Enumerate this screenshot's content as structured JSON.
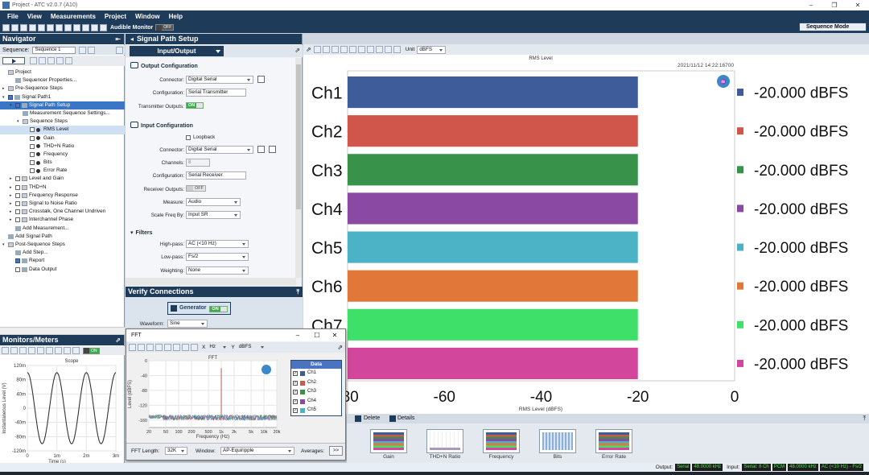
{
  "window": {
    "title": "Project - ATC v2.0.7 (A10)",
    "controls": [
      "–",
      "❐",
      "✕"
    ]
  },
  "menu": [
    "File",
    "View",
    "Measurements",
    "Project",
    "Window",
    "Help"
  ],
  "toolbar": {
    "audible_monitor_label": "Audible Monitor",
    "audible_monitor_state": "OFF",
    "sequence_mode": "Sequence Mode"
  },
  "navigator": {
    "title": "Navigator",
    "sequence_label": "Sequence:",
    "sequence_value": "Sequence 1",
    "tree": [
      {
        "label": "Project",
        "level": 0,
        "icon": "folder",
        "arrow": "",
        "check": ""
      },
      {
        "label": "Sequencer Properties...",
        "level": 1,
        "icon": "gear",
        "arrow": "",
        "check": ""
      },
      {
        "label": "Pre-Sequence Steps",
        "level": 0,
        "icon": "folder",
        "arrow": "▸",
        "check": ""
      },
      {
        "label": "Signal Path1",
        "level": 0,
        "icon": "box",
        "arrow": "▾",
        "check": "on"
      },
      {
        "label": "Signal Path Setup",
        "level": 1,
        "icon": "box",
        "arrow": "▾",
        "check": "on",
        "state": "selected"
      },
      {
        "label": "Measurement Sequence Settings...",
        "level": 2,
        "icon": "gear",
        "arrow": "",
        "check": ""
      },
      {
        "label": "Sequence Steps",
        "level": 2,
        "icon": "folder",
        "arrow": "▾",
        "check": ""
      },
      {
        "label": "RMS Level",
        "level": 3,
        "icon": "dot",
        "arrow": "",
        "check": "off",
        "state": "highlight"
      },
      {
        "label": "Gain",
        "level": 3,
        "icon": "dot",
        "arrow": "",
        "check": "off"
      },
      {
        "label": "THD+N Ratio",
        "level": 3,
        "icon": "dot",
        "arrow": "",
        "check": "off"
      },
      {
        "label": "Frequency",
        "level": 3,
        "icon": "dot",
        "arrow": "",
        "check": "off"
      },
      {
        "label": "Bits",
        "level": 3,
        "icon": "dot",
        "arrow": "",
        "check": "off"
      },
      {
        "label": "Error Rate",
        "level": 3,
        "icon": "dot",
        "arrow": "",
        "check": "off"
      },
      {
        "label": "Level and Gain",
        "level": 1,
        "icon": "folder",
        "arrow": "▸",
        "check": "off"
      },
      {
        "label": "THD+N",
        "level": 1,
        "icon": "folder",
        "arrow": "▸",
        "check": "off"
      },
      {
        "label": "Frequency Response",
        "level": 1,
        "icon": "folder",
        "arrow": "▸",
        "check": "off"
      },
      {
        "label": "Signal to Noise Ratio",
        "level": 1,
        "icon": "folder",
        "arrow": "▸",
        "check": "off"
      },
      {
        "label": "Crosstalk, One Channel Undriven",
        "level": 1,
        "icon": "folder",
        "arrow": "▸",
        "check": "off"
      },
      {
        "label": "Interchannel Phase",
        "level": 1,
        "icon": "folder",
        "arrow": "▸",
        "check": "off"
      },
      {
        "label": "Add Measurement...",
        "level": 1,
        "icon": "box",
        "arrow": "",
        "check": ""
      },
      {
        "label": "Add Signal Path",
        "level": 0,
        "icon": "box",
        "arrow": "",
        "check": ""
      },
      {
        "label": "Post-Sequence Steps",
        "level": 0,
        "icon": "folder",
        "arrow": "▾",
        "check": ""
      },
      {
        "label": "Add Step...",
        "level": 1,
        "icon": "box",
        "arrow": "",
        "check": ""
      },
      {
        "label": "Report",
        "level": 1,
        "icon": "box",
        "arrow": "",
        "check": "on"
      },
      {
        "label": "Data Output",
        "level": 1,
        "icon": "box",
        "arrow": "",
        "check": "off"
      }
    ]
  },
  "monitors": {
    "title": "Monitors/Meters",
    "toggle": "ON",
    "scope": {
      "title": "Scope",
      "ylabel": "Instantaneous Level (V)",
      "xlabel": "Time (s)",
      "yticks": [
        "120m",
        "80m",
        "40m",
        "0",
        "-40m",
        "-80m",
        "-120m"
      ],
      "xticks": [
        "0",
        "1m",
        "2m",
        "3m"
      ],
      "amplitude": 0.1,
      "cycles": 3,
      "ylim": [
        -0.12,
        0.12
      ],
      "xlim": [
        0,
        0.003
      ]
    }
  },
  "signal_path_setup": {
    "title": "Signal Path Setup",
    "tab": "Input/Output",
    "output_configuration": {
      "heading": "Output Configuration",
      "connector_label": "Connector:",
      "connector": "Digital Serial",
      "configuration_label": "Configuration:",
      "configuration": "Serial Transmitter",
      "transmitter_outputs_label": "Transmitter Outputs:",
      "transmitter_outputs": "ON"
    },
    "input_configuration": {
      "heading": "Input Configuration",
      "loopback": "Loopback",
      "connector_label": "Connector:",
      "connector": "Digital Serial",
      "channels_label": "Channels:",
      "channels": "8",
      "configuration_label": "Configuration:",
      "configuration": "Serial Receiver",
      "receiver_outputs_label": "Receiver Outputs:",
      "receiver_outputs": "OFF",
      "measure_label": "Measure:",
      "measure": "Audio",
      "scale_label": "Scale Freq By:",
      "scale": "Input SR"
    },
    "filters": {
      "heading": "Filters",
      "highpass_label": "High-pass:",
      "highpass": "AC (<10 Hz)",
      "lowpass_label": "Low-pass:",
      "lowpass": "Fs/2",
      "weighting_label": "Weighting:",
      "weighting": "None"
    }
  },
  "verify_connections": {
    "title": "Verify Connections",
    "generator_label": "Generator",
    "generator_state": "ON",
    "waveform_label": "Waveform:",
    "waveform": "Sine"
  },
  "main_graph": {
    "unit_label": "Unit",
    "unit": "dBFS",
    "title": "RMS Level",
    "timestamp": "2021/11/12 14:22:16700",
    "xlabel": "RMS Level (dBFS)",
    "accent": "#2b4c70"
  },
  "chart_data": [
    {
      "type": "bar",
      "orientation": "horizontal",
      "title": "RMS Level",
      "xlabel": "RMS Level (dBFS)",
      "categories": [
        "Ch1",
        "Ch2",
        "Ch3",
        "Ch4",
        "Ch5",
        "Ch6",
        "Ch7",
        "Ch8"
      ],
      "values": [
        -20,
        -20,
        -20,
        -20,
        -20,
        -20,
        -20,
        -20
      ],
      "value_labels": [
        "-20.000 dBFS",
        "-20.000 dBFS",
        "-20.000 dBFS",
        "-20.000 dBFS",
        "-20.000 dBFS",
        "-20.000 dBFS",
        "-20.000 dBFS",
        "-20.000 dBFS"
      ],
      "colors": [
        "#3e5b9a",
        "#d0554b",
        "#38924a",
        "#8a49a3",
        "#4cb2c5",
        "#e2773a",
        "#3fe06a",
        "#d2479b"
      ],
      "xlim": [
        -80,
        0
      ],
      "xticks": [
        "-80",
        "-60",
        "-40",
        "-20",
        "0"
      ],
      "legend": "right"
    },
    {
      "type": "line",
      "title": "FFT",
      "xlabel": "Frequency (Hz)",
      "ylabel": "Level (dBFS)",
      "x_scale": "log",
      "xticks": [
        "20",
        "50",
        "100",
        "200",
        "500",
        "1k",
        "2k",
        "5k",
        "10k",
        "20k"
      ],
      "yticks": [
        "0",
        "-40",
        "-80",
        "-120",
        "-160"
      ],
      "ylim": [
        -180,
        0
      ],
      "xlim": [
        20,
        20000
      ],
      "peak": {
        "x": 1000,
        "y": -20
      },
      "noise_floor": -160,
      "series": [
        {
          "name": "Ch1",
          "color": "#3e5b9a"
        },
        {
          "name": "Ch2",
          "color": "#d0554b"
        },
        {
          "name": "Ch3",
          "color": "#38924a"
        },
        {
          "name": "Ch4",
          "color": "#8a49a3"
        },
        {
          "name": "Ch5",
          "color": "#4cb2c5"
        }
      ]
    }
  ],
  "fft_window": {
    "title": "FFT",
    "controls": [
      "–",
      "☐",
      "✕"
    ],
    "x_label": "X",
    "x_unit": "Hz",
    "y_label": "Y",
    "y_unit": "dBFS",
    "data_header": "Data",
    "fft_length_label": "FFT Length:",
    "fft_length": "32K",
    "window_label": "Window:",
    "window": "AP-Equiripple",
    "averages_label": "Averages:",
    "averages_btn": ">>"
  },
  "results_strip": {
    "delete": "Delete",
    "details": "Details",
    "thumbnails": [
      "Gain",
      "THD+N Ratio",
      "Frequency",
      "Bits",
      "Error Rate"
    ]
  },
  "status_bar": {
    "output_label": "Output:",
    "output_items": [
      "Serial",
      "48.0000 kHz"
    ],
    "input_label": "Input:",
    "input_items": [
      "Serial: 8 Ch",
      "PCM",
      "48.0000 kHz",
      "AC (<10 Hz) - Fs/2"
    ]
  }
}
